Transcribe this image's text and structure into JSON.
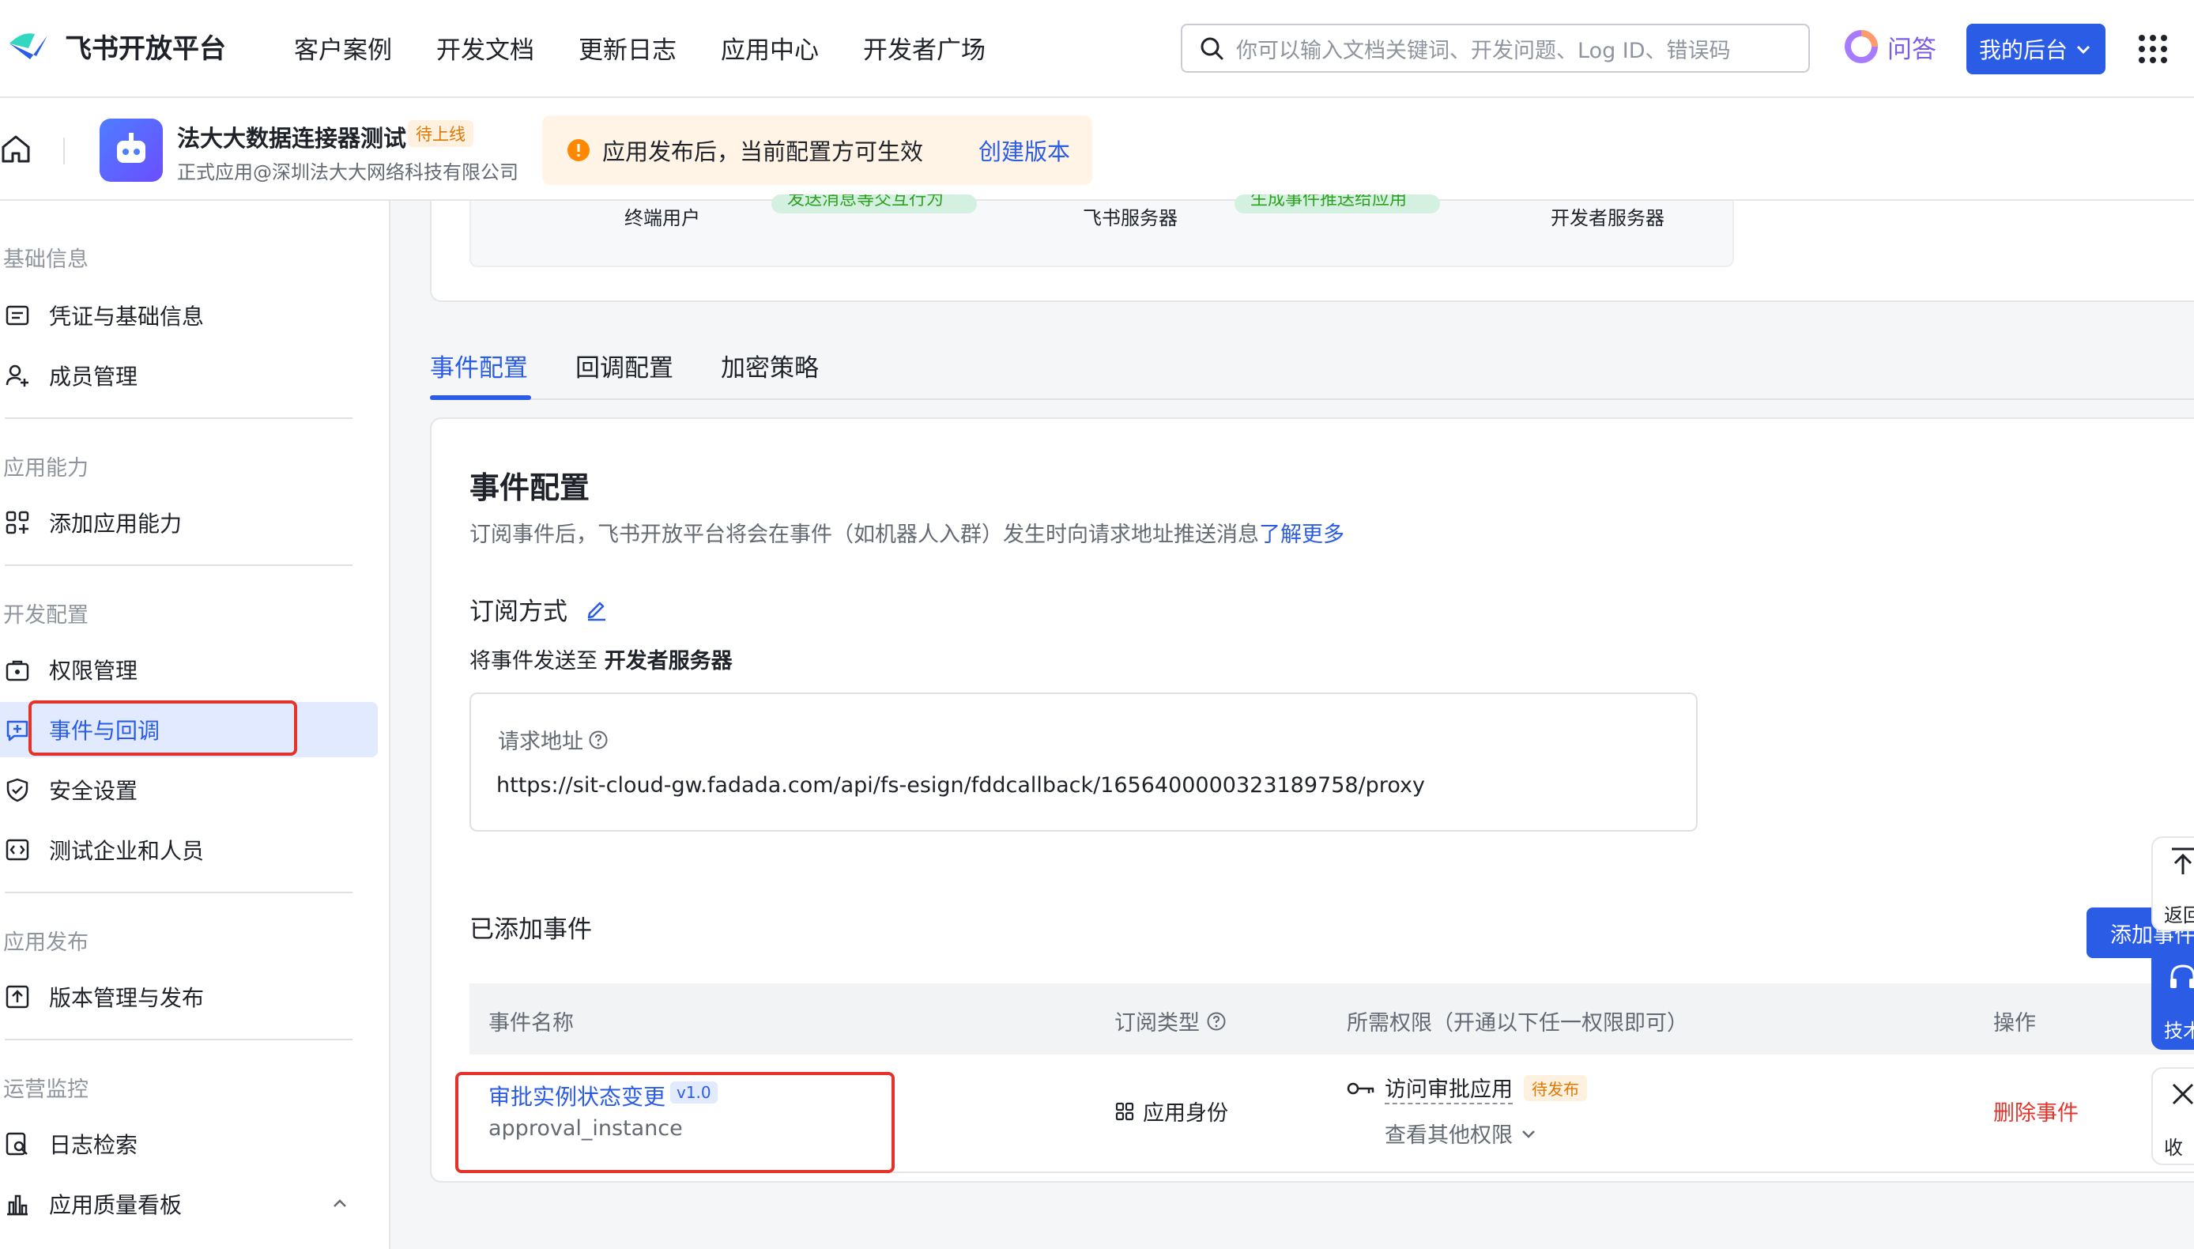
{
  "brand": {
    "name": "飞书开放平台",
    "accent": "#2b5ce6"
  },
  "nav": [
    "客户案例",
    "开发文档",
    "更新日志",
    "应用中心",
    "开发者广场"
  ],
  "search": {
    "placeholder": "你可以输入文档关键词、开发问题、Log ID、错误码"
  },
  "ask_label": "问答",
  "my_console": "我的后台",
  "app": {
    "name": "法大大数据连接器测试",
    "status": "待上线",
    "org": "正式应用@深圳法大大网络科技有限公司"
  },
  "notice": {
    "text": "应用发布后，当前配置方可生效",
    "link": "创建版本"
  },
  "sidebar": {
    "sections": [
      {
        "label": "基础信息",
        "items": [
          "凭证与基础信息",
          "成员管理"
        ]
      },
      {
        "label": "应用能力",
        "items": [
          "添加应用能力"
        ]
      },
      {
        "label": "开发配置",
        "items": [
          "权限管理",
          "事件与回调",
          "安全设置",
          "测试企业和人员"
        ]
      },
      {
        "label": "应用发布",
        "items": [
          "版本管理与发布"
        ]
      },
      {
        "label": "运营监控",
        "items": [
          "日志检索",
          "应用质量看板"
        ]
      }
    ],
    "active_item": "事件与回调"
  },
  "diagram": {
    "labels": [
      "终端用户",
      "飞书服务器",
      "开发者服务器"
    ],
    "pills": [
      "发送消息等交互行为",
      "生成事件推送给应用"
    ]
  },
  "tabs": [
    "事件配置",
    "回调配置",
    "加密策略"
  ],
  "event_config": {
    "title": "事件配置",
    "desc": "订阅事件后，飞书开放平台将会在事件（如机器人入群）发生时向请求地址推送消息",
    "learn_more": "了解更多",
    "subscribe_title": "订阅方式",
    "send_to_prefix": "将事件发送至",
    "send_to_target": "开发者服务器",
    "request_url_label": "请求地址",
    "request_url": "https://sit-cloud-gw.fadada.com/api/fs-esign/fddcallback/1656400000323189758/proxy",
    "added_title": "已添加事件",
    "add_button": "添加事件"
  },
  "table": {
    "headers": [
      "事件名称",
      "订阅类型",
      "所需权限（开通以下任一权限即可）",
      "操作"
    ],
    "rows": [
      {
        "name": "审批实例状态变更",
        "version": "v1.0",
        "key": "approval_instance",
        "type": "应用身份",
        "permission": "访问审批应用",
        "permission_status": "待发布",
        "more_permissions": "查看其他权限",
        "action": "删除事件"
      }
    ]
  },
  "float": {
    "back": "返回",
    "tech": "技术",
    "collapse": "收"
  }
}
